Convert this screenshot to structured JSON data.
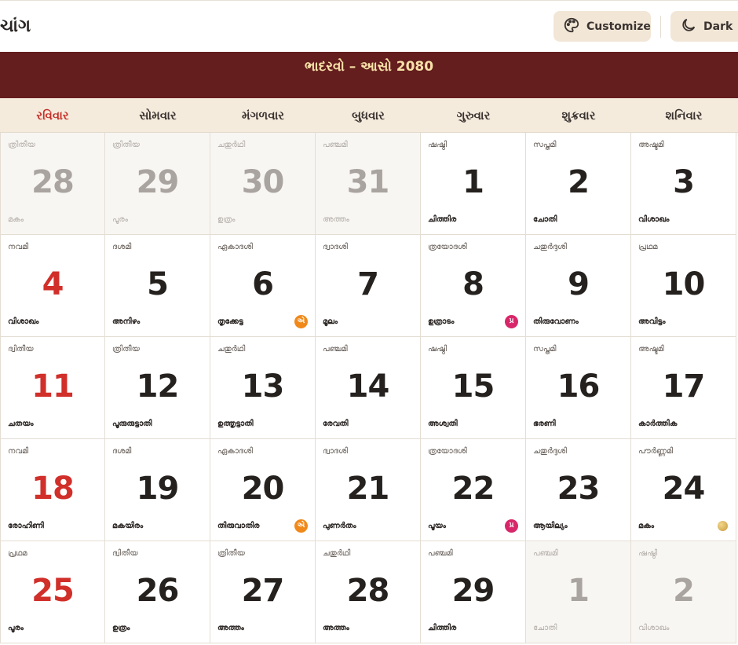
{
  "header": {
    "app_title": "ચાંગ",
    "customize_label": "Customize",
    "theme_label": "Dark"
  },
  "banner": {
    "title": "ભાદરવો – આસો 2080"
  },
  "weekdays": [
    "રવિવાર",
    "સોમવાર",
    "મંગળવાર",
    "બુધવાર",
    "ગુરુવાર",
    "શુક્રવાર",
    "શનિવાર"
  ],
  "colors": {
    "banner_bg": "#641e1e",
    "banner_text": "#f6e1a8",
    "sunday": "#d12f2a",
    "ekadashi_badge": "#f0891a",
    "pradosh_badge": "#d8266a"
  },
  "days": [
    {
      "num": "28",
      "tithi": "ത്രിതീയ",
      "star": "മകം",
      "other": true,
      "badge": ""
    },
    {
      "num": "29",
      "tithi": "ത്രിതീയ",
      "star": "പൂരം",
      "other": true,
      "badge": ""
    },
    {
      "num": "30",
      "tithi": "ചതുർഥി",
      "star": "ഉത്രം",
      "other": true,
      "badge": ""
    },
    {
      "num": "31",
      "tithi": "പഞ്ചമി",
      "star": "അത്തം",
      "other": true,
      "badge": ""
    },
    {
      "num": "1",
      "tithi": "ഷഷ്ഠി",
      "star": "ചിത്തിര",
      "other": false,
      "badge": ""
    },
    {
      "num": "2",
      "tithi": "സപ്തമി",
      "star": "ചോതി",
      "other": false,
      "badge": ""
    },
    {
      "num": "3",
      "tithi": "അഷ്ടമി",
      "star": "വിശാഖം",
      "other": false,
      "badge": ""
    },
    {
      "num": "4",
      "tithi": "നവമി",
      "star": "വിശാഖം",
      "other": false,
      "badge": ""
    },
    {
      "num": "5",
      "tithi": "ദശമി",
      "star": "അനിഴം",
      "other": false,
      "badge": ""
    },
    {
      "num": "6",
      "tithi": "ഏകാദശി",
      "star": "തൃക്കേട്ട",
      "other": false,
      "badge": "ekadashi",
      "badge_text": "એ"
    },
    {
      "num": "7",
      "tithi": "ദ്വാദശി",
      "star": "മൂലം",
      "other": false,
      "badge": ""
    },
    {
      "num": "8",
      "tithi": "ത്രയോദശി",
      "star": "ഉത്രാടം",
      "other": false,
      "badge": "pradosh",
      "badge_text": "પ્ર"
    },
    {
      "num": "9",
      "tithi": "ചതുർദ്ദശി",
      "star": "തിരുവോണം",
      "other": false,
      "badge": ""
    },
    {
      "num": "10",
      "tithi": "പ്രഥമ",
      "star": "അവിട്ടം",
      "other": false,
      "badge": ""
    },
    {
      "num": "11",
      "tithi": "ദ്വിതീയ",
      "star": "ചതയം",
      "other": false,
      "badge": ""
    },
    {
      "num": "12",
      "tithi": "ത്രിതീയ",
      "star": "പൂരുരുട്ടാതി",
      "other": false,
      "badge": ""
    },
    {
      "num": "13",
      "tithi": "ചതുർഥി",
      "star": "ഉത്തൃട്ടാതി",
      "other": false,
      "badge": ""
    },
    {
      "num": "14",
      "tithi": "പഞ്ചമി",
      "star": "രേവതി",
      "other": false,
      "badge": ""
    },
    {
      "num": "15",
      "tithi": "ഷഷ്ഠി",
      "star": "അശ്വതി",
      "other": false,
      "badge": ""
    },
    {
      "num": "16",
      "tithi": "സപ്തമി",
      "star": "ഭരണി",
      "other": false,
      "badge": ""
    },
    {
      "num": "17",
      "tithi": "അഷ്ടമി",
      "star": "കാർത്തിക",
      "other": false,
      "badge": ""
    },
    {
      "num": "18",
      "tithi": "നവമി",
      "star": "രോഹിണി",
      "other": false,
      "badge": ""
    },
    {
      "num": "19",
      "tithi": "ദശമി",
      "star": "മകയിരം",
      "other": false,
      "badge": ""
    },
    {
      "num": "20",
      "tithi": "ഏകാദശി",
      "star": "തിരുവാതിര",
      "other": false,
      "badge": "ekadashi",
      "badge_text": "એ"
    },
    {
      "num": "21",
      "tithi": "ദ്വാദശി",
      "star": "പുണർതം",
      "other": false,
      "badge": ""
    },
    {
      "num": "22",
      "tithi": "ത്രയോദശി",
      "star": "പൂയം",
      "other": false,
      "badge": "pradosh",
      "badge_text": "પ્ર"
    },
    {
      "num": "23",
      "tithi": "ചതുർദ്ദശി",
      "star": "ആയില്യം",
      "other": false,
      "badge": ""
    },
    {
      "num": "24",
      "tithi": "പൗർണ്ണമി",
      "star": "മകം",
      "other": false,
      "badge": "moon"
    },
    {
      "num": "25",
      "tithi": "പ്രഥമ",
      "star": "പൂരം",
      "other": false,
      "badge": ""
    },
    {
      "num": "26",
      "tithi": "ദ്വിതീയ",
      "star": "ഉത്രം",
      "other": false,
      "badge": ""
    },
    {
      "num": "27",
      "tithi": "ത്രിതീയ",
      "star": "അത്തം",
      "other": false,
      "badge": ""
    },
    {
      "num": "28",
      "tithi": "ചതുർഥി",
      "star": "അത്തം",
      "other": false,
      "badge": ""
    },
    {
      "num": "29",
      "tithi": "പഞ്ചമി",
      "star": "ചിത്തിര",
      "other": false,
      "badge": ""
    },
    {
      "num": "1",
      "tithi": "പഞ്ചമി",
      "star": "ചോതി",
      "other": true,
      "badge": ""
    },
    {
      "num": "2",
      "tithi": "ഷഷ്ഠി",
      "star": "വിശാഖം",
      "other": true,
      "badge": ""
    }
  ]
}
